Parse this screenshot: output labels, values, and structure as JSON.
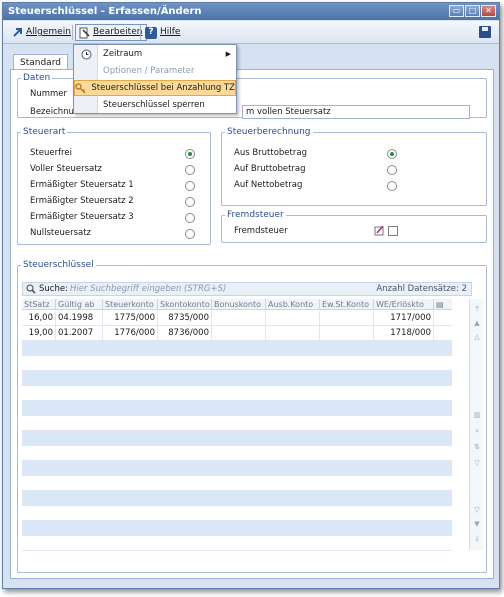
{
  "window": {
    "title": "Steuerschlüssel - Erfassen/Ändern",
    "buttons": {
      "minimize": "minimize-icon",
      "maximize": "maximize-icon",
      "close": "close-icon"
    }
  },
  "menubar": {
    "allgemein": "Allgemein",
    "bearbeiten": "Bearbeiten",
    "hilfe": "Hilfe"
  },
  "dropdown": {
    "items": [
      {
        "label": "Zeitraum",
        "icon": "clock-icon",
        "submenu": true,
        "disabled": false,
        "highlighted": false
      },
      {
        "label": "Optionen / Parameter",
        "icon": "",
        "submenu": false,
        "disabled": true,
        "highlighted": false
      },
      {
        "label": "Steuerschlüssel bei Anzahlung TZ",
        "icon": "key-icon",
        "submenu": false,
        "disabled": false,
        "highlighted": true
      },
      {
        "label": "Steuerschlüssel sperren",
        "icon": "",
        "submenu": false,
        "disabled": false,
        "highlighted": false
      }
    ]
  },
  "tabs": [
    "Standard"
  ],
  "daten": {
    "legend": "Daten",
    "nummer_label": "Nummer",
    "bezeichnung_label": "Bezeichnun",
    "bezeichnung_value": "m vollen Steuersatz"
  },
  "steuerart": {
    "legend": "Steuerart",
    "options": [
      "Steuerfrei",
      "Voller Steuersatz",
      "Ermäßigter Steuersatz 1",
      "Ermäßigter Steuersatz 2",
      "Ermäßigter Steuersatz 3",
      "Nullsteuersatz"
    ],
    "selected": 0
  },
  "steuerberechnung": {
    "legend": "Steuerberechnung",
    "options": [
      "Aus Bruttobetrag",
      "Auf Bruttobetrag",
      "Auf Nettobetrag"
    ],
    "selected": 0
  },
  "fremdsteuer": {
    "legend": "Fremdsteuer",
    "label": "Fremdsteuer",
    "checked": false
  },
  "steuerschluessel": {
    "legend": "Steuerschlüssel",
    "search_label": "Suche:",
    "search_placeholder": "Hier Suchbegriff eingeben (STRG+S)",
    "count_label": "Anzahl Datensätze: 2",
    "columns": [
      "StSatz",
      "Gültig ab",
      "Steuerkonto",
      "Skontokonto",
      "Bonuskonto",
      "Ausb.Konto",
      "Ew.St.Konto",
      "WE/Erlöskto"
    ],
    "rows": [
      [
        "16,00",
        "04.1998",
        "1775/000",
        "8735/000",
        "",
        "",
        "",
        "1717/000"
      ],
      [
        "19,00",
        "01.2007",
        "1776/000",
        "8736/000",
        "",
        "",
        "",
        "1718/000"
      ]
    ]
  },
  "colors": {
    "accent": "#4c72a8",
    "highlight": "#fdd999",
    "row_alt": "#dae7f7"
  }
}
